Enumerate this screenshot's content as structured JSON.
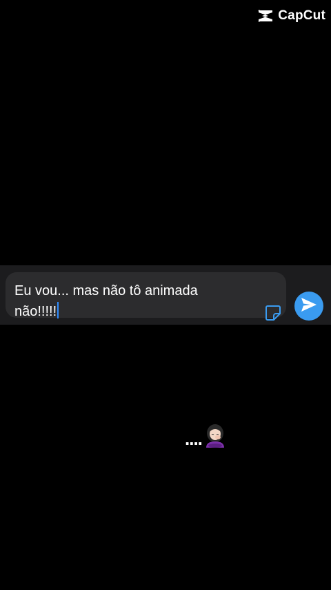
{
  "watermark": {
    "brand": "CapCut",
    "icon": "capcut-logo-icon"
  },
  "composer": {
    "text": "Eu vou... mas não tô animada não!!!!!",
    "sticker_icon": "sticker-icon",
    "send_icon": "send-arrow-icon",
    "send_color": "#3a9bf0",
    "caret_color": "#2f8cff"
  },
  "caption": {
    "dots": "....",
    "emoji": "woman-with-hand-on-cheek-emoji"
  }
}
